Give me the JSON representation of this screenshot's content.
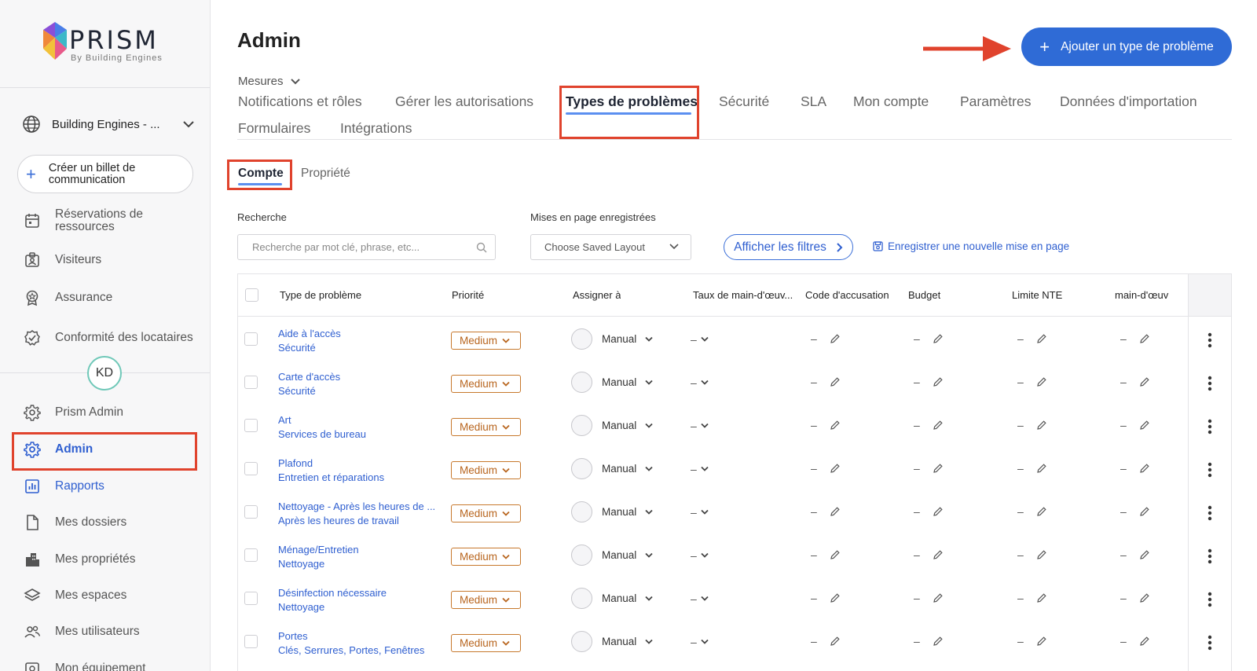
{
  "sidebar": {
    "logo": {
      "title": "PRISM",
      "subtitle": "By Building Engines"
    },
    "org": {
      "label": "Building Engines - ..."
    },
    "create_ticket": {
      "label": "Créer un billet de communication"
    },
    "items_top": [
      {
        "label": "Réservations de ressources",
        "icon": "calendar-icon"
      },
      {
        "label": "Visiteurs",
        "icon": "visitor-badge-icon"
      },
      {
        "label": "Assurance",
        "icon": "award-icon"
      },
      {
        "label": "Conformité des locataires",
        "icon": "check-badge-icon"
      }
    ],
    "avatar": "KD",
    "items_bottom": [
      {
        "label": "Prism Admin",
        "icon": "gear-icon"
      },
      {
        "label": "Admin",
        "icon": "gear-icon",
        "active": true
      },
      {
        "label": "Rapports",
        "icon": "chart-icon"
      },
      {
        "label": "Mes dossiers",
        "icon": "file-icon"
      },
      {
        "label": "Mes propriétés",
        "icon": "building-icon"
      },
      {
        "label": "Mes espaces",
        "icon": "layers-icon"
      },
      {
        "label": "Mes utilisateurs",
        "icon": "users-icon"
      },
      {
        "label": "Mon équipement",
        "icon": "equipment-icon"
      }
    ]
  },
  "header": {
    "title": "Admin",
    "add_button": "Ajouter un type de problème",
    "mesures": "Mesures"
  },
  "tabs": [
    "Notifications et rôles",
    "Gérer les autorisations",
    "Types de problèmes",
    "Sécurité",
    "SLA",
    "Mon compte",
    "Paramètres",
    "Données d'importation",
    "Formulaires",
    "Intégrations"
  ],
  "active_tab": "Types de problèmes",
  "subtabs": [
    "Compte",
    "Propriété"
  ],
  "filters": {
    "search_label": "Recherche",
    "search_placeholder": "Recherche par mot clé, phrase, etc...",
    "layout_label": "Mises en page enregistrées",
    "layout_value": "Choose Saved Layout",
    "show_filters": "Afficher les filtres",
    "save_layout": "Enregistrer une nouvelle mise en page"
  },
  "table": {
    "columns": [
      "Type de problème",
      "Priorité",
      "Assigner à",
      "Taux de main-d'œuv...",
      "Code d'accusation",
      "Budget",
      "Limite NTE",
      "main-d'œuv"
    ],
    "rows": [
      {
        "type": "Aide à l'accès",
        "category": "Sécurité",
        "priority": "Medium",
        "assign": "Manual",
        "rate": "–",
        "code": "–",
        "budget": "–",
        "nte": "–",
        "labor": "–"
      },
      {
        "type": "Carte d'accès",
        "category": "Sécurité",
        "priority": "Medium",
        "assign": "Manual",
        "rate": "–",
        "code": "–",
        "budget": "–",
        "nte": "–",
        "labor": "–"
      },
      {
        "type": "Art",
        "category": "Services de bureau",
        "priority": "Medium",
        "assign": "Manual",
        "rate": "–",
        "code": "–",
        "budget": "–",
        "nte": "–",
        "labor": "–"
      },
      {
        "type": "Plafond",
        "category": "Entretien et réparations",
        "priority": "Medium",
        "assign": "Manual",
        "rate": "–",
        "code": "–",
        "budget": "–",
        "nte": "–",
        "labor": "–"
      },
      {
        "type": "Nettoyage - Après les heures de ...",
        "category": "Après les heures de travail",
        "priority": "Medium",
        "assign": "Manual",
        "rate": "–",
        "code": "–",
        "budget": "–",
        "nte": "–",
        "labor": "–"
      },
      {
        "type": "Ménage/Entretien",
        "category": "Nettoyage",
        "priority": "Medium",
        "assign": "Manual",
        "rate": "–",
        "code": "–",
        "budget": "–",
        "nte": "–",
        "labor": "–"
      },
      {
        "type": "Désinfection nécessaire",
        "category": "Nettoyage",
        "priority": "Medium",
        "assign": "Manual",
        "rate": "–",
        "code": "–",
        "budget": "–",
        "nte": "–",
        "labor": "–"
      },
      {
        "type": "Portes",
        "category": "Clés, Serrures, Portes, Fenêtres",
        "priority": "Medium",
        "assign": "Manual",
        "rate": "–",
        "code": "–",
        "budget": "–",
        "nte": "–",
        "labor": "–"
      }
    ]
  },
  "colors": {
    "accent": "#2f6bd6",
    "highlight": "#e0432d",
    "priority": "#c7782c"
  }
}
